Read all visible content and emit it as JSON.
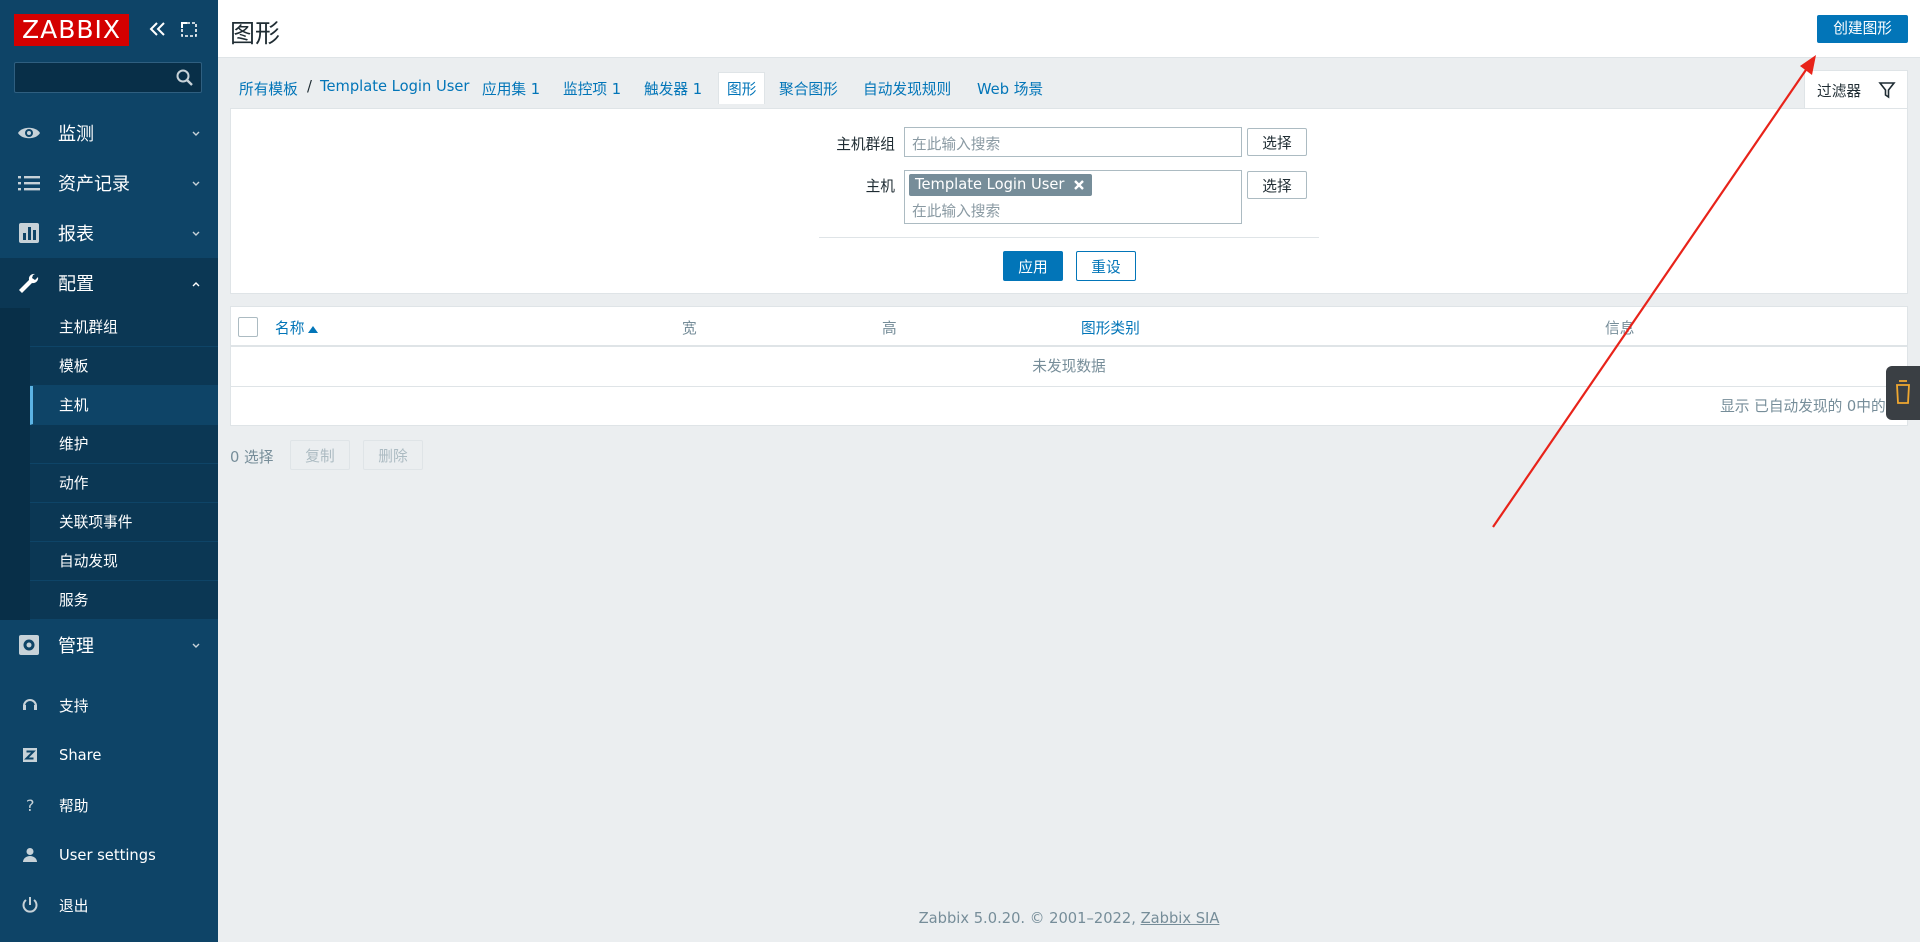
{
  "sidebar": {
    "logo": "ZABBIX",
    "search_placeholder": "",
    "menu": [
      {
        "label": "监测",
        "icon": "eye-icon"
      },
      {
        "label": "资产记录",
        "icon": "list-icon"
      },
      {
        "label": "报表",
        "icon": "chart-icon"
      },
      {
        "label": "配置",
        "icon": "wrench-icon"
      },
      {
        "label": "管理",
        "icon": "gear-icon"
      }
    ],
    "config_submenu": [
      "主机群组",
      "模板",
      "主机",
      "维护",
      "动作",
      "关联项事件",
      "自动发现",
      "服务"
    ],
    "bottom": [
      {
        "label": "支持",
        "icon": "headset-icon"
      },
      {
        "label": "Share",
        "icon": "zabbix-share-icon"
      },
      {
        "label": "帮助",
        "icon": "question-icon"
      },
      {
        "label": "User settings",
        "icon": "user-icon"
      },
      {
        "label": "退出",
        "icon": "power-icon"
      }
    ]
  },
  "header": {
    "title": "图形",
    "create_button": "创建图形"
  },
  "tabs": {
    "all_templates": "所有模板",
    "separator": "/",
    "template_name": "Template Login User",
    "applications": "应用集 1",
    "items": "监控项 1",
    "triggers": "触发器 1",
    "graphs": "图形",
    "screens": "聚合图形",
    "discovery": "自动发现规则",
    "web": "Web 场景",
    "filter": "过滤器"
  },
  "filter": {
    "host_group_label": "主机群组",
    "host_group_placeholder": "在此输入搜索",
    "host_label": "主机",
    "host_chip": "Template Login User",
    "host_placeholder": "在此输入搜索",
    "select_button": "选择",
    "apply_button": "应用",
    "reset_button": "重设"
  },
  "table": {
    "columns": [
      "名称",
      "宽",
      "高",
      "图形类别",
      "信息"
    ],
    "empty_text": "未发现数据",
    "paging_text": "显示 已自动发现的 0中的0"
  },
  "actions": {
    "selected": "0 选择",
    "copy": "复制",
    "delete": "删除"
  },
  "footer": {
    "text": "Zabbix 5.0.20. © 2001–2022, ",
    "link": "Zabbix SIA"
  },
  "colors": {
    "sidebar_bg": "#0e4467",
    "accent": "#0275b8",
    "logo_red": "#d40000",
    "annotation_arrow": "#e8231a"
  }
}
